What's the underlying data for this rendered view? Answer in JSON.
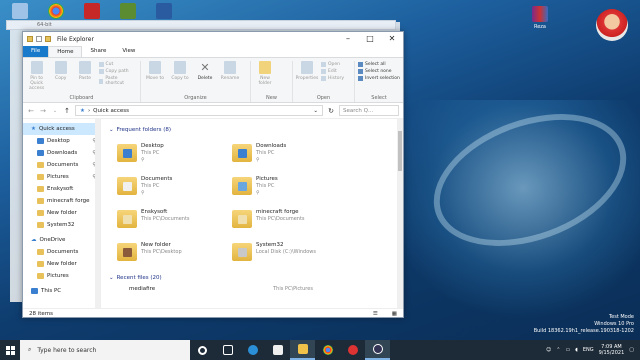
{
  "desktop": {
    "background_color": "#1d5f9e",
    "watermark": [
      "Test Mode",
      "Windows 10 Pro",
      "Build 18362.19h1_release.190318-1202",
      "Build 18362.19h1_release.190318-1202"
    ],
    "icon_labels": [
      "Reza"
    ]
  },
  "explorer": {
    "title": "File Explorer",
    "bg_window_title": "64-bit",
    "tabs": [
      "File",
      "Home",
      "Share",
      "View"
    ],
    "ribbon": {
      "clipboard": {
        "group": "Clipboard",
        "pin": "Pin to Quick access",
        "copy": "Copy",
        "paste": "Paste",
        "cut": "Cut",
        "copy_path": "Copy path",
        "paste_shortcut": "Paste shortcut"
      },
      "organize": {
        "group": "Organize",
        "move_to": "Move to",
        "copy_to": "Copy to",
        "delete": "Delete",
        "rename": "Rename"
      },
      "new": {
        "group": "New",
        "new_folder": "New folder"
      },
      "open": {
        "group": "Open",
        "properties": "Properties",
        "open": "Open",
        "edit": "Edit",
        "history": "History"
      },
      "select": {
        "group": "Select",
        "select_all": "Select all",
        "select_none": "Select none",
        "invert": "Invert selection"
      }
    },
    "address": {
      "path": "Quick access",
      "search_placeholder": "Search Q..."
    },
    "nav": [
      {
        "label": "Quick access",
        "level": 0,
        "icon": "star-icon",
        "selected": true
      },
      {
        "label": "Desktop",
        "level": 1,
        "icon": "blue",
        "pinned": true
      },
      {
        "label": "Downloads",
        "level": 1,
        "icon": "blue",
        "pinned": true
      },
      {
        "label": "Documents",
        "level": 1,
        "icon": "yellow",
        "pinned": true
      },
      {
        "label": "Pictures",
        "level": 1,
        "icon": "yellow",
        "pinned": true
      },
      {
        "label": "Enskysoft",
        "level": 1,
        "icon": "yellow"
      },
      {
        "label": "minecraft forge",
        "level": 1,
        "icon": "yellow"
      },
      {
        "label": "New folder",
        "level": 1,
        "icon": "yellow"
      },
      {
        "label": "System32",
        "level": 1,
        "icon": "yellow"
      },
      {
        "label": "OneDrive",
        "level": 0,
        "icon": "cloud"
      },
      {
        "label": "Documents",
        "level": 1,
        "icon": "yellow"
      },
      {
        "label": "New folder",
        "level": 1,
        "icon": "yellow"
      },
      {
        "label": "Pictures",
        "level": 1,
        "icon": "yellow"
      },
      {
        "label": "This PC",
        "level": 0,
        "icon": "pc"
      }
    ],
    "frequent_header": "Frequent folders (8)",
    "frequent": [
      {
        "name": "Desktop",
        "loc": "This PC",
        "pinned": true,
        "overlay": "#3a7fd0"
      },
      {
        "name": "Downloads",
        "loc": "This PC",
        "pinned": true,
        "overlay": "#3a7fd0"
      },
      {
        "name": "Documents",
        "loc": "This PC",
        "pinned": true,
        "overlay": "#f0f0f0"
      },
      {
        "name": "Pictures",
        "loc": "This PC",
        "pinned": true,
        "overlay": "#6aa6e0"
      },
      {
        "name": "Enskysoft",
        "loc": "This PC\\Documents",
        "pinned": false,
        "overlay": "#f0e0b0"
      },
      {
        "name": "minecraft forge",
        "loc": "This PC\\Documents",
        "pinned": false,
        "overlay": "#f0e0b0"
      },
      {
        "name": "New folder",
        "loc": "This PC\\Desktop",
        "pinned": false,
        "overlay": "#8a5a3a"
      },
      {
        "name": "System32",
        "loc": "Local Disk (C:)\\Windows",
        "pinned": false,
        "overlay": "#c8c8c8"
      }
    ],
    "recent_header": "Recent files (20)",
    "recent": [
      {
        "name": "mediafire",
        "path": "This PC\\Pictures"
      }
    ],
    "status": "28 items"
  },
  "taskbar": {
    "search_placeholder": "Type here to search",
    "lang": "ENG",
    "time": "7:09 AM",
    "date": "9/15/2021"
  }
}
